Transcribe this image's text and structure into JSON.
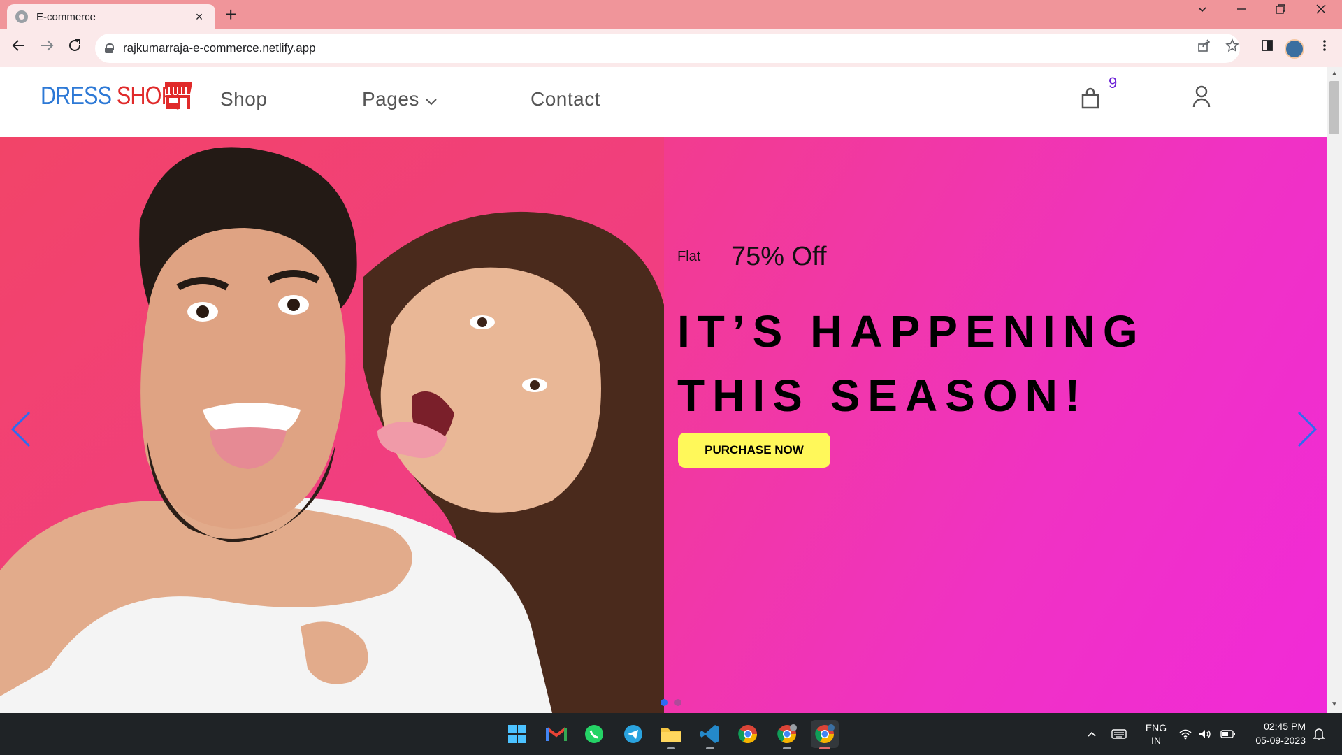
{
  "browser": {
    "tab_title": "E-commerce",
    "tab_close": "×",
    "new_tab": "+",
    "url": "rajkumarraja-e-commerce.netlify.app"
  },
  "site": {
    "logo_dress": "DRESS",
    "logo_shop": "SHOP",
    "logo_divider": "|",
    "nav": {
      "shop": "Shop",
      "pages": "Pages",
      "contact": "Contact"
    },
    "cart_count": "9"
  },
  "hero": {
    "flat_label": "Flat",
    "offer": "75% Off",
    "headline": "IT’S HAPPENING THIS SEASON!",
    "cta": "PURCHASE NOW",
    "active_slide": 1,
    "slide_count": 2
  },
  "taskbar": {
    "lang_top": "ENG",
    "lang_bottom": "IN",
    "time": "02:45 PM",
    "date": "05-09-2023"
  },
  "colors": {
    "accent_blue": "#2d79d6",
    "accent_red": "#e02a2a",
    "cta_yellow": "#fff85a",
    "cart_badge": "#6a1fd6"
  }
}
